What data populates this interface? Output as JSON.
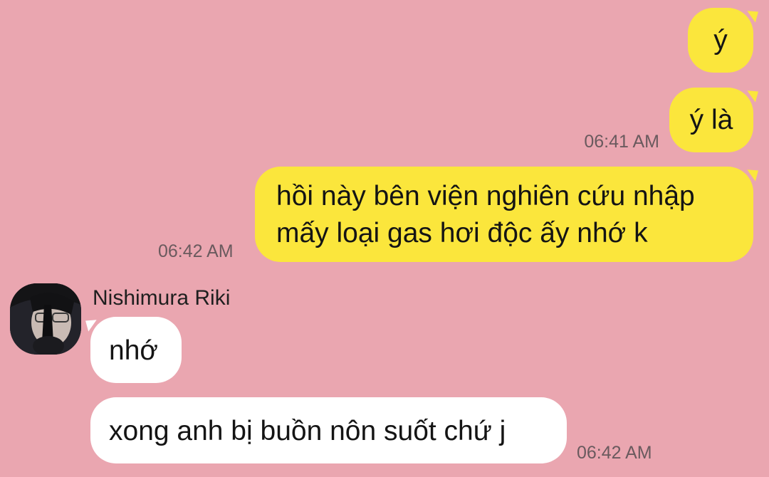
{
  "chat": {
    "contact_name": "Nishimura Riki",
    "sent": [
      {
        "text": "ý"
      },
      {
        "text": "ý là",
        "time": "06:41 AM"
      },
      {
        "text_line1": "hồi này bên viện nghiên cứu nhập",
        "text_line2": "mấy loại gas hơi độc ấy nhớ k",
        "time": "06:42 AM"
      }
    ],
    "received": [
      {
        "text": "nhớ"
      },
      {
        "text": "xong anh bị buồn nôn suốt chứ j",
        "time": "06:42 AM"
      }
    ]
  },
  "colors": {
    "background": "#eaa6b0",
    "sent_bubble": "#fbe63c",
    "received_bubble": "#ffffff",
    "time_text": "#6a5a5e"
  }
}
